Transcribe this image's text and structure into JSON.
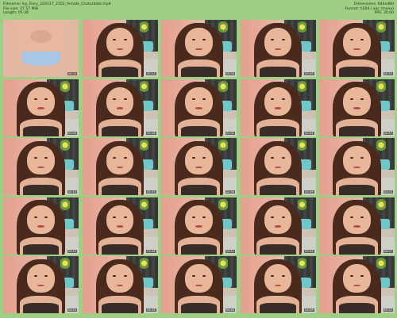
{
  "header": {
    "left": [
      "Filename: Ivy_Fiory_220117_2102_female_Chaturbate.mp4",
      "File size: 37.57 MiB",
      "Length: 05:26"
    ],
    "right": [
      "Dimensions: 640x480",
      "Format: h264 / aac (mono)",
      "FPS: 30.00"
    ]
  },
  "thumbnails": [
    {
      "timestamp": "00:00"
    },
    {
      "timestamp": "00:13"
    },
    {
      "timestamp": "00:26"
    },
    {
      "timestamp": "00:39"
    },
    {
      "timestamp": "00:52"
    },
    {
      "timestamp": "01:05"
    },
    {
      "timestamp": "01:18"
    },
    {
      "timestamp": "01:31"
    },
    {
      "timestamp": "01:44"
    },
    {
      "timestamp": "01:57"
    },
    {
      "timestamp": "02:10"
    },
    {
      "timestamp": "02:23"
    },
    {
      "timestamp": "02:36"
    },
    {
      "timestamp": "02:49"
    },
    {
      "timestamp": "03:02"
    },
    {
      "timestamp": "03:15"
    },
    {
      "timestamp": "03:28"
    },
    {
      "timestamp": "03:41"
    },
    {
      "timestamp": "03:54"
    },
    {
      "timestamp": "04:07"
    },
    {
      "timestamp": "04:20"
    },
    {
      "timestamp": "04:33"
    },
    {
      "timestamp": "04:46"
    },
    {
      "timestamp": "04:59"
    },
    {
      "timestamp": "05:12"
    }
  ],
  "colors": {
    "background": "#9fcf84",
    "header_text": "#1d2b14"
  }
}
